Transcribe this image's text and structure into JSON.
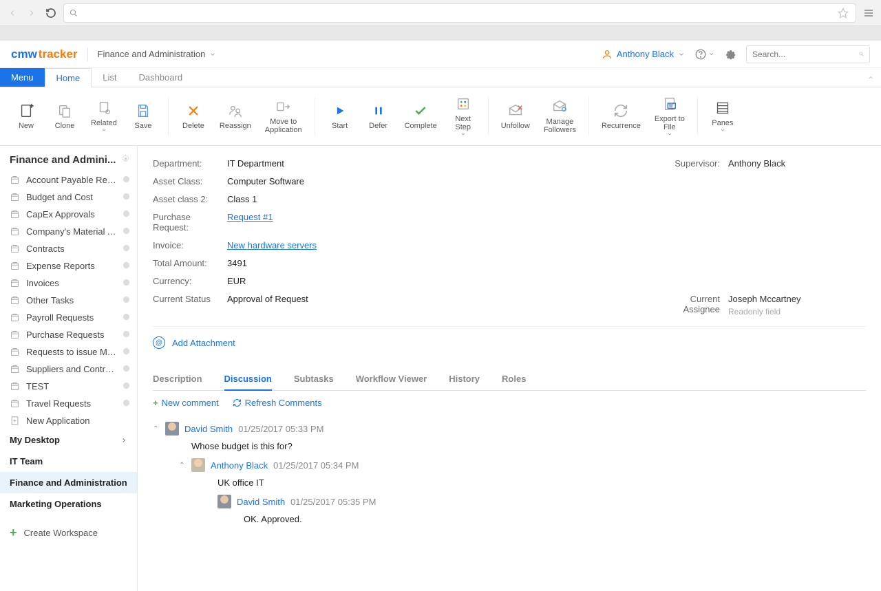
{
  "browser": {
    "address": "",
    "star_title": ""
  },
  "header": {
    "logo_cmw": "cmw",
    "logo_tracker": "tracker",
    "breadcrumb": "Finance and Administration",
    "user": "Anthony Black",
    "search_placeholder": "Search..."
  },
  "main_tabs": {
    "menu": "Menu",
    "home": "Home",
    "list": "List",
    "dashboard": "Dashboard"
  },
  "ribbon": {
    "new": "New",
    "clone": "Clone",
    "related": "Related",
    "save": "Save",
    "delete": "Delete",
    "reassign": "Reassign",
    "move_to_app": "Move to\nApplication",
    "start": "Start",
    "defer": "Defer",
    "complete": "Complete",
    "next_step": "Next\nStep",
    "unfollow": "Unfollow",
    "manage_followers": "Manage\nFollowers",
    "recurrence": "Recurrence",
    "export_to_file": "Export to\nFile",
    "panes": "Panes"
  },
  "sidebar": {
    "title": "Finance and Admini...",
    "items": [
      "Account Payable Requ...",
      "Budget and Cost",
      "CapEx Approvals",
      "Company's Material A...",
      "Contracts",
      "Expense Reports",
      "Invoices",
      "Other Tasks",
      "Payroll Requests",
      "Purchase Requests",
      "Requests to issue Mat...",
      "Suppliers and Contrac...",
      "TEST",
      "Travel Requests",
      "New Application"
    ],
    "sections": {
      "my_desktop": "My Desktop",
      "it_team": "IT Team",
      "finance_admin": "Finance and Administration",
      "marketing": "Marketing Operations"
    },
    "create": "Create Workspace"
  },
  "form": {
    "labels": {
      "department": "Department:",
      "supervisor": "Supervisor:",
      "asset_class": "Asset Class:",
      "asset_class2": "Asset class 2:",
      "purchase_request": "Purchase Request:",
      "invoice": "Invoice:",
      "total_amount": "Total Amount:",
      "currency": "Currency:",
      "current_status": "Current Status",
      "current_assignee": "Current Assignee"
    },
    "values": {
      "department": "IT Department",
      "supervisor": "Anthony Black",
      "asset_class": "Computer Software",
      "asset_class2": "Class 1",
      "purchase_request": "Request #1",
      "invoice": "New hardware servers",
      "total_amount": "3491",
      "currency": "EUR",
      "current_status": "Approval of Request",
      "current_assignee": "Joseph Mccartney",
      "readonly_hint": "Readonly field"
    },
    "add_attachment": "Add Attachment"
  },
  "sub_tabs": {
    "description": "Description",
    "discussion": "Discussion",
    "subtasks": "Subtasks",
    "workflow": "Workflow Viewer",
    "history": "History",
    "roles": "Roles"
  },
  "comment_actions": {
    "new_comment": "New comment",
    "refresh": "Refresh Comments"
  },
  "comments": [
    {
      "author": "David Smith",
      "ts": "01/25/2017 05:33 PM",
      "body": "Whose budget is this for?",
      "level": 0
    },
    {
      "author": "Anthony Black",
      "ts": "01/25/2017 05:34 PM",
      "body": "UK office IT",
      "level": 1
    },
    {
      "author": "David Smith",
      "ts": "01/25/2017 05:35 PM",
      "body": "OK. Approved.",
      "level": 2
    }
  ]
}
